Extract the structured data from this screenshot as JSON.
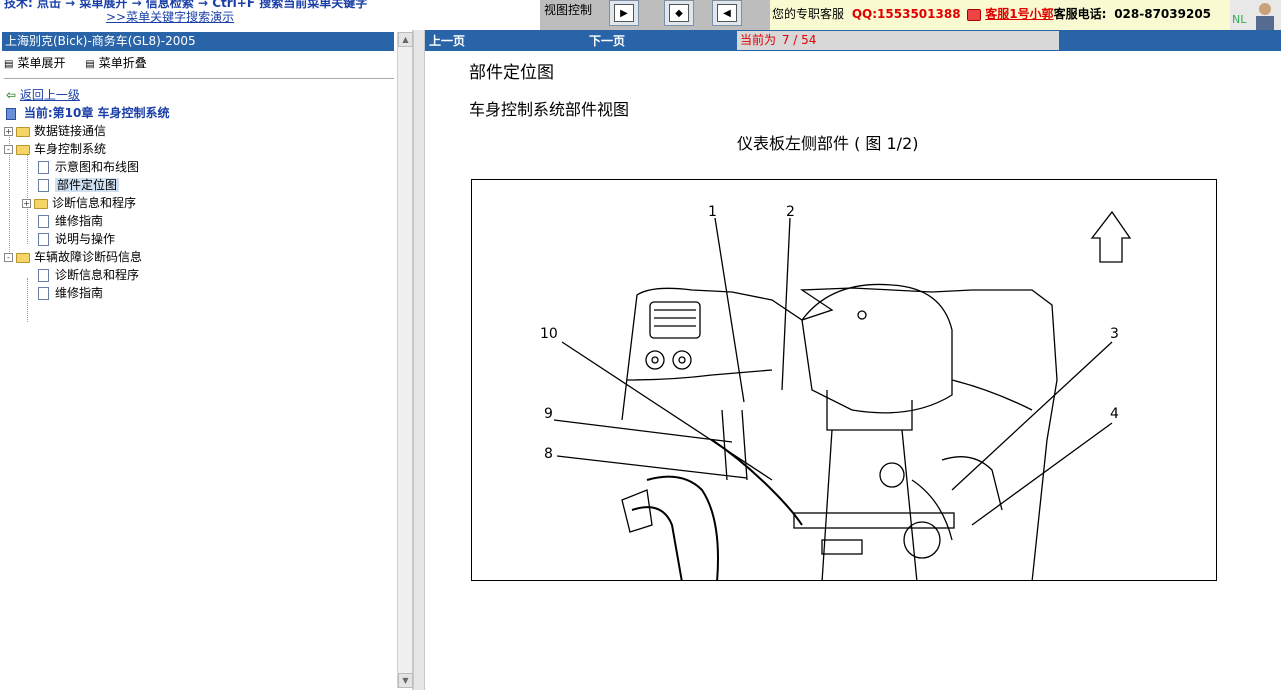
{
  "topbar": {
    "cut_text": "技术: 点击 → 菜单展开 → 信息检索 → Ctrl+F 搜索当前菜单关键字",
    "demo_link": ">>菜单关键字搜索演示",
    "view_label": "视图控制",
    "buttons": [
      {
        "icon": "expand-right-icon",
        "glyph": "▶"
      },
      {
        "icon": "split-view-icon",
        "glyph": "◆"
      },
      {
        "icon": "collapse-left-icon",
        "glyph": "◀"
      }
    ],
    "service_label": "您的专职客服",
    "qq": "QQ:1553501388",
    "cs_name": "客服1号小郭",
    "phone_label": "客服电话:",
    "phone": "028-87039205",
    "avatar_text": "NL"
  },
  "left": {
    "title": "上海别克(Bick)-商务车(GL8)-2005",
    "expand_label": "菜单展开",
    "collapse_label": "菜单折叠",
    "back_label": "返回上一级",
    "current_label": "当前:第10章  车身控制系统",
    "tree": [
      {
        "label": "数据链接通信",
        "type": "folder",
        "level": 0,
        "toggle": "+"
      },
      {
        "label": "车身控制系统",
        "type": "folder",
        "level": 0,
        "toggle": "-"
      },
      {
        "label": "示意图和布线图",
        "type": "doc",
        "level": 1
      },
      {
        "label": "部件定位图",
        "type": "doc",
        "level": 1,
        "selected": true
      },
      {
        "label": "诊断信息和程序",
        "type": "folder",
        "level": 1,
        "toggle": "+"
      },
      {
        "label": "维修指南",
        "type": "doc",
        "level": 1
      },
      {
        "label": "说明与操作",
        "type": "doc",
        "level": 1
      },
      {
        "label": "车辆故障诊断码信息",
        "type": "folder",
        "level": 0,
        "toggle": "-"
      },
      {
        "label": "诊断信息和程序",
        "type": "doc",
        "level": 1
      },
      {
        "label": "维修指南",
        "type": "doc",
        "level": 1
      }
    ]
  },
  "nav": {
    "prev": "上一页",
    "next": "下一页",
    "page_prefix": "当前为",
    "page_value": "7 / 54"
  },
  "content": {
    "title1": "部件定位图",
    "title2": "车身控制系统部件视图",
    "title3": "仪表板左侧部件 ( 图 1/2)",
    "callouts": [
      "1",
      "2",
      "3",
      "4",
      "8",
      "9",
      "10"
    ]
  }
}
